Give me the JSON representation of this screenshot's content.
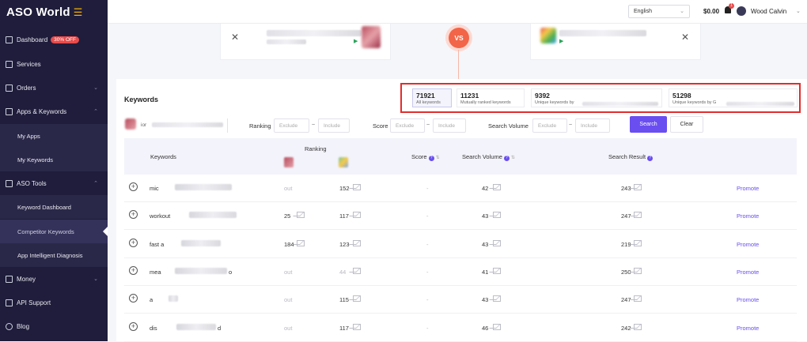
{
  "brand": {
    "name": "ASO World"
  },
  "sidebar": {
    "items": [
      {
        "label": "Dashboard",
        "badge": "30% OFF"
      },
      {
        "label": "Services"
      },
      {
        "label": "Orders"
      },
      {
        "label": "Apps & Keywords"
      },
      {
        "label": "My Apps"
      },
      {
        "label": "My Keywords"
      },
      {
        "label": "ASO Tools"
      },
      {
        "label": "Keyword Dashboard"
      },
      {
        "label": "Competitor Keywords"
      },
      {
        "label": "App Intelligent Diagnosis"
      },
      {
        "label": "Money"
      },
      {
        "label": "API Support"
      },
      {
        "label": "Blog"
      }
    ]
  },
  "topbar": {
    "language": "English",
    "balance": "$0.00",
    "notifications": "1",
    "username": "Wood Calvin"
  },
  "compare": {
    "vs_label": "VS"
  },
  "keywords": {
    "title": "Keywords",
    "stats": [
      {
        "value": "71921",
        "label": "All keywords"
      },
      {
        "value": "11231",
        "label": "Mutually ranked keywords"
      },
      {
        "value": "9392",
        "label": "Unique keywords by"
      },
      {
        "value": "51298",
        "label": "Unique keywords by G"
      }
    ],
    "filters": {
      "app_text": "ior",
      "ranking_label": "Ranking",
      "score_label": "Score",
      "search_volume_label": "Search Volume",
      "exclude_placeholder": "Exclude",
      "include_placeholder": "Include",
      "dash": "~",
      "search_button": "Search",
      "clear_button": "Clear"
    },
    "table": {
      "headers": {
        "keywords": "Keywords",
        "ranking": "Ranking",
        "score": "Score",
        "search_volume": "Search Volume",
        "search_result": "Search Result"
      },
      "rows": [
        {
          "keyword": "mic",
          "rank_a": "out",
          "rank_b": "152",
          "score": "-",
          "volume": "42",
          "result": "243",
          "action": "Promote"
        },
        {
          "keyword": "workout",
          "rank_a": "25",
          "rank_b": "117",
          "score": "-",
          "volume": "43",
          "result": "247",
          "action": "Promote"
        },
        {
          "keyword": "fast a",
          "rank_a": "184",
          "rank_b": "123",
          "score": "-",
          "volume": "43",
          "result": "219",
          "action": "Promote"
        },
        {
          "keyword": "mea",
          "keyword_suffix": "o",
          "rank_a": "out",
          "rank_b": "44",
          "score": "-",
          "volume": "41",
          "result": "250",
          "action": "Promote"
        },
        {
          "keyword": "a",
          "rank_a": "out",
          "rank_b": "115",
          "score": "-",
          "volume": "43",
          "result": "247",
          "action": "Promote"
        },
        {
          "keyword": "dis",
          "keyword_suffix": "d",
          "rank_a": "out",
          "rank_b": "117",
          "score": "-",
          "volume": "46",
          "result": "242",
          "action": "Promote"
        }
      ]
    }
  }
}
